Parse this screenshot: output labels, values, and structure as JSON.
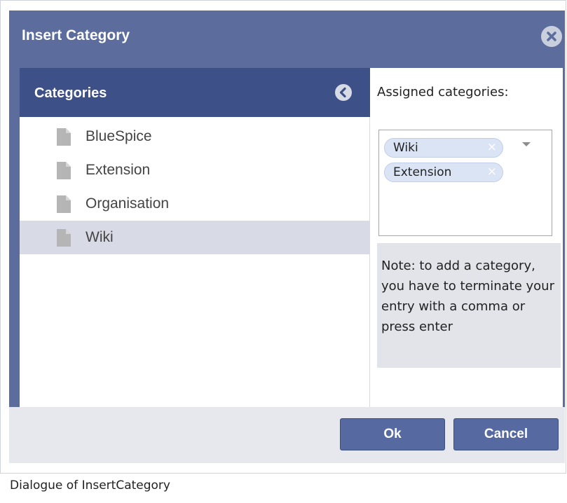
{
  "dialog": {
    "title": "Insert Category",
    "close_icon": "close-icon"
  },
  "categories_panel": {
    "title": "Categories",
    "collapse_icon": "chevron-left-icon",
    "items": [
      {
        "label": "BlueSpice",
        "icon": "document-icon",
        "selected": false
      },
      {
        "label": "Extension",
        "icon": "document-icon",
        "selected": false
      },
      {
        "label": "Organisation",
        "icon": "document-icon",
        "selected": false
      },
      {
        "label": "Wiki",
        "icon": "document-icon",
        "selected": true
      }
    ]
  },
  "assigned": {
    "label": "Assigned categories:",
    "tags": [
      {
        "label": "Wiki",
        "remove": "×"
      },
      {
        "label": "Extension",
        "remove": "×"
      }
    ],
    "note": "Note: to add a category, you have to terminate your entry with a comma or press enter"
  },
  "footer": {
    "ok_label": "Ok",
    "cancel_label": "Cancel"
  },
  "caption": "Dialogue of InsertCategory",
  "colors": {
    "dialog_bg": "#5b6c9d",
    "panel_header": "#3d5088",
    "selected_row": "#d8dbe6",
    "button": "#5669a0"
  }
}
